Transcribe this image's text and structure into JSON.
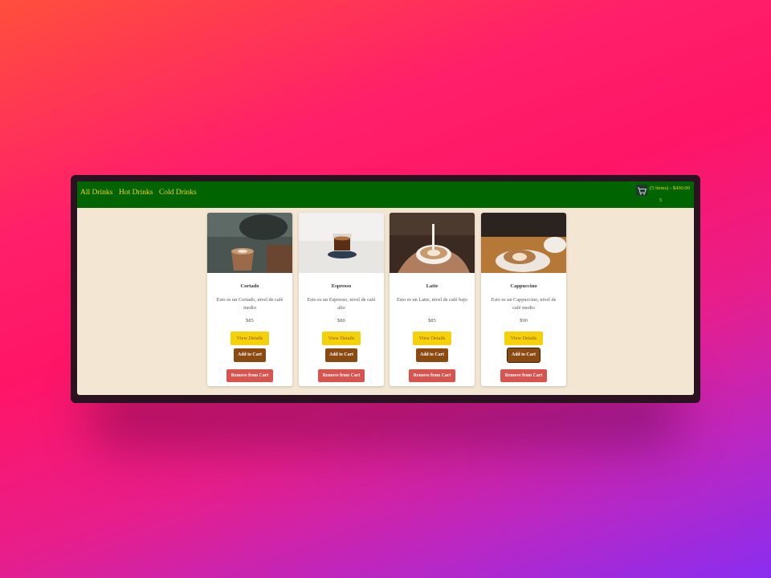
{
  "nav": {
    "links": [
      "All Drinks",
      "Hot Drinks",
      "Cold Drinks"
    ]
  },
  "cart": {
    "summary": "(5 items) - $430.00",
    "count": "5",
    "icon": "shopping-cart-icon"
  },
  "products": [
    {
      "name": "Cortado",
      "description": "Esto es un Cortado, nivel de café medio",
      "price": "$85",
      "image": "cortado-photo"
    },
    {
      "name": "Espresso",
      "description": "Esto es un Espresso, nivel de café alto",
      "price": "$80",
      "image": "espresso-photo"
    },
    {
      "name": "Latte",
      "description": "Esto es un Latte, nivel de café bajo",
      "price": "$85",
      "image": "latte-photo"
    },
    {
      "name": "Cappuccino",
      "description": "Esto es un Cappuccino, nivel de café medio",
      "price": "$90",
      "image": "cappuccino-photo"
    }
  ],
  "buttons": {
    "view_details": "View Details",
    "add_to_cart": "Add to Cart",
    "remove_from_cart": "Remove from Cart"
  },
  "colors": {
    "navbar": "#006400",
    "nav_text": "#f2d40a",
    "page_background": "#f3e6d3",
    "details_button": "#f5d10a",
    "add_button": "#8b4a12",
    "remove_button": "#d9534f"
  }
}
